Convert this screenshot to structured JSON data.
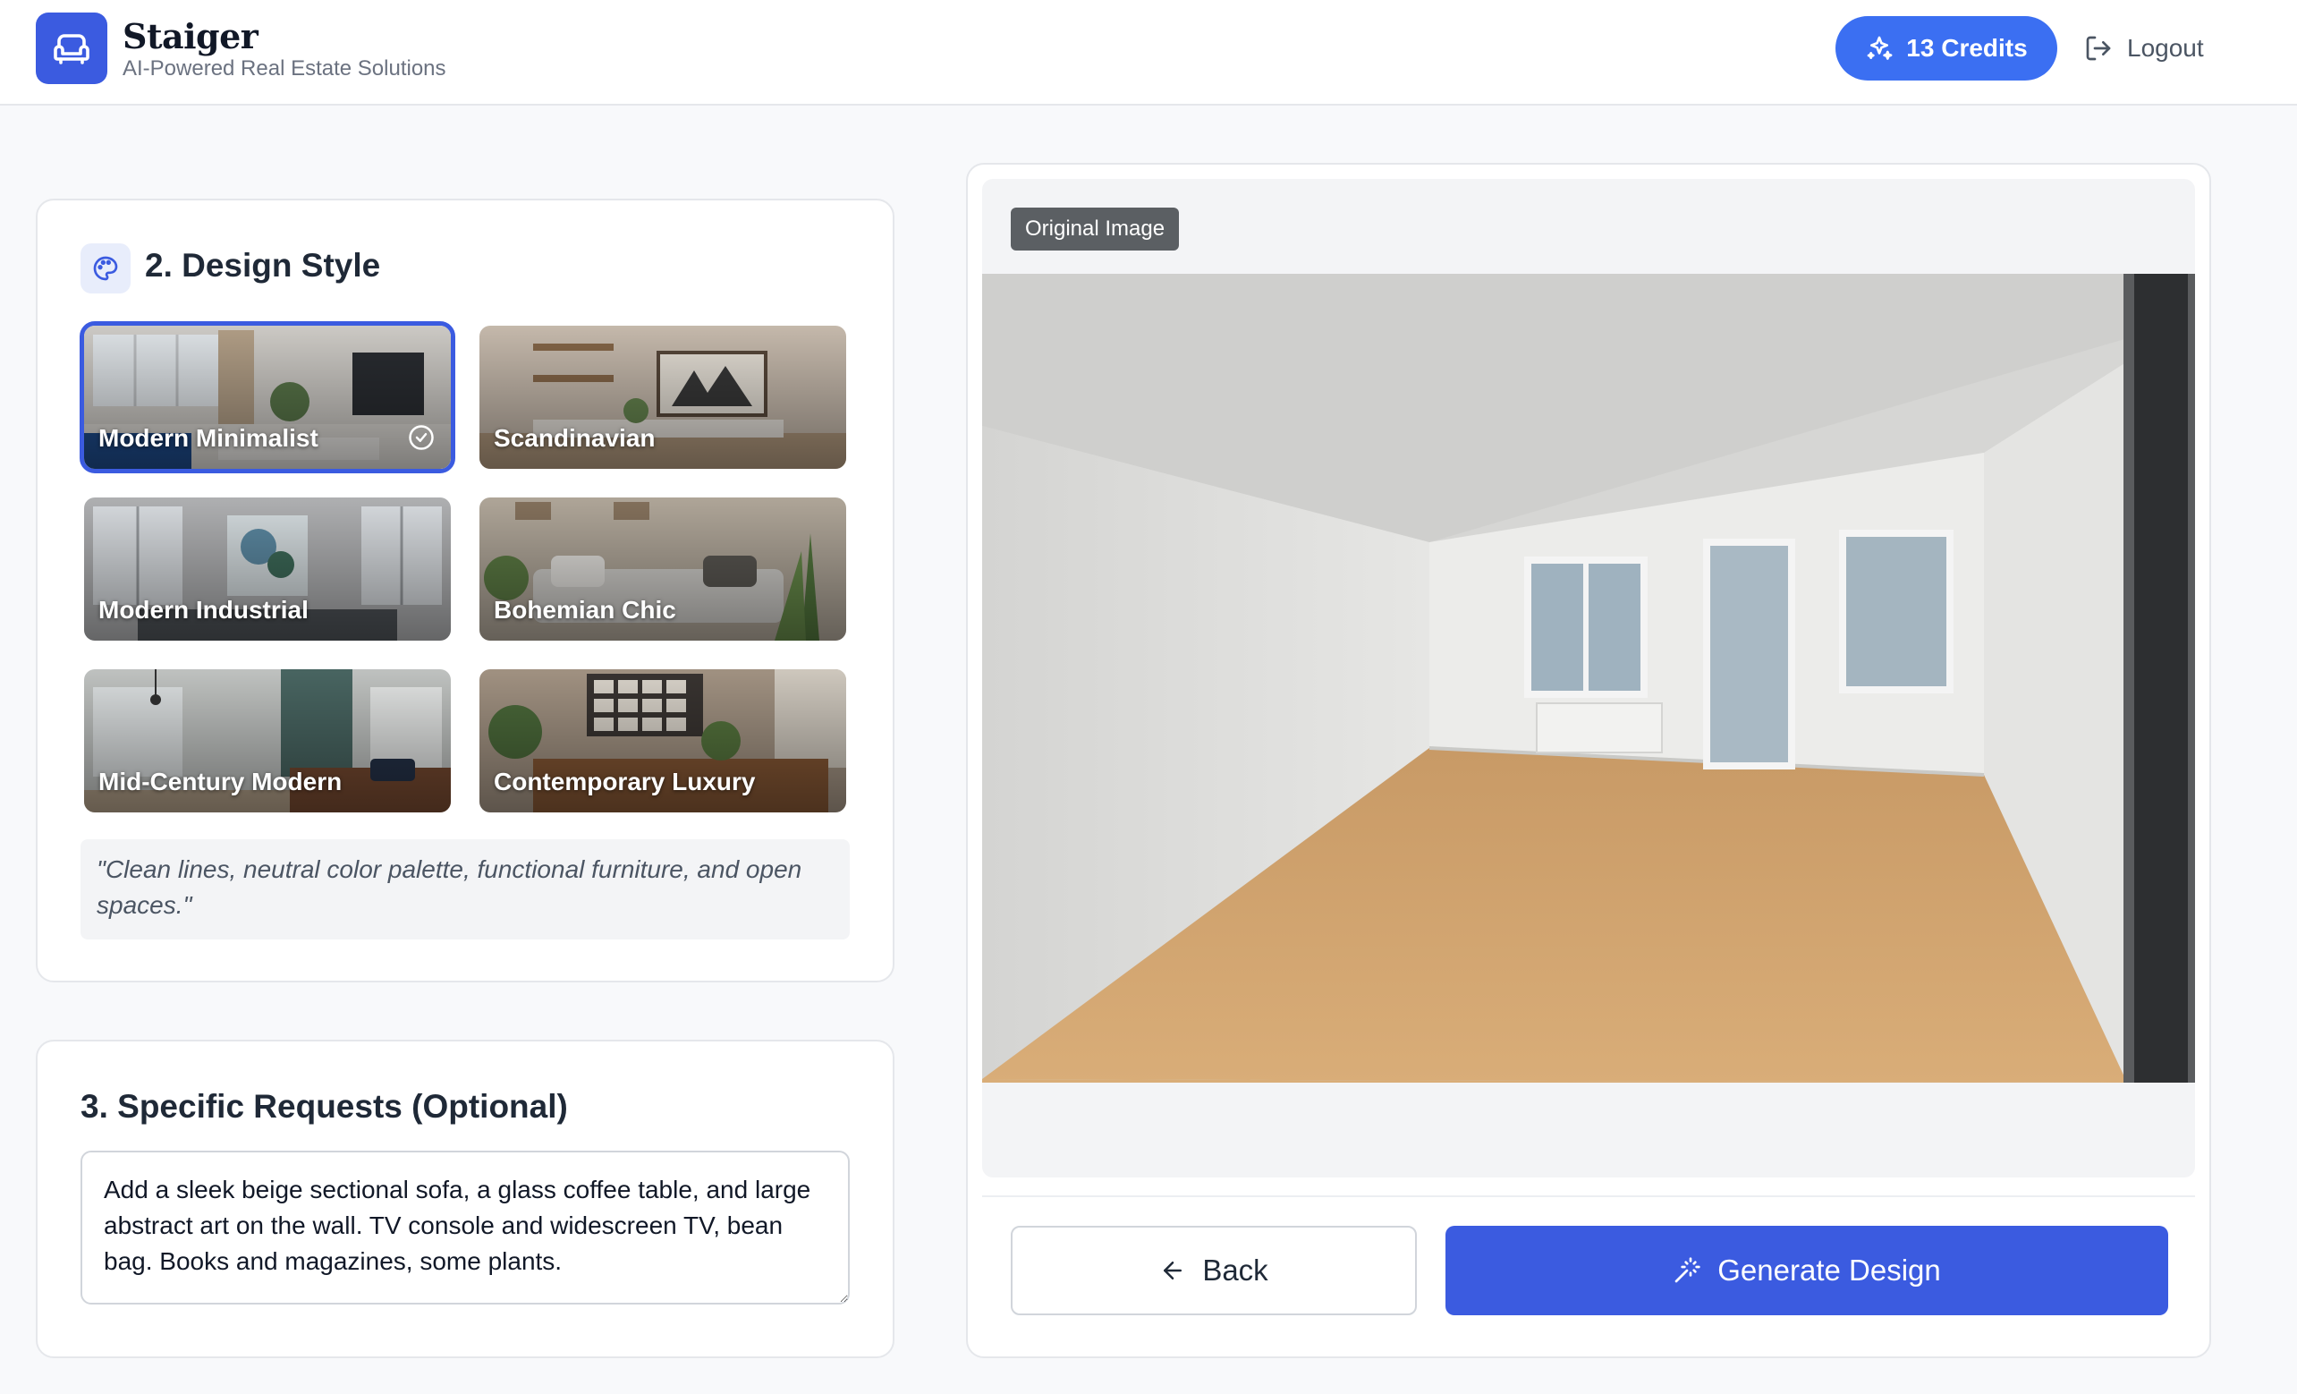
{
  "header": {
    "brand_name": "Staiger",
    "brand_tagline": "AI-Powered Real Estate Solutions",
    "credits_label": "13 Credits",
    "logout_label": "Logout"
  },
  "design_style": {
    "title": "2. Design Style",
    "styles": [
      {
        "label": "Modern Minimalist",
        "selected": true
      },
      {
        "label": "Scandinavian",
        "selected": false
      },
      {
        "label": "Modern Industrial",
        "selected": false
      },
      {
        "label": "Bohemian Chic",
        "selected": false
      },
      {
        "label": "Mid-Century Modern",
        "selected": false
      },
      {
        "label": "Contemporary Luxury",
        "selected": false
      }
    ],
    "description": "\"Clean lines, neutral color palette, functional furniture, and open spaces.\""
  },
  "requests": {
    "title": "3. Specific Requests (Optional)",
    "value": "Add a sleek beige sectional sofa, a glass coffee table, and large abstract art on the wall. TV console and widescreen TV, bean bag. Books and magazines, some plants."
  },
  "preview": {
    "badge": "Original Image"
  },
  "actions": {
    "back_label": "Back",
    "generate_label": "Generate Design"
  },
  "colors": {
    "accent": "#3b5be0",
    "credits": "#3b6ff2"
  }
}
